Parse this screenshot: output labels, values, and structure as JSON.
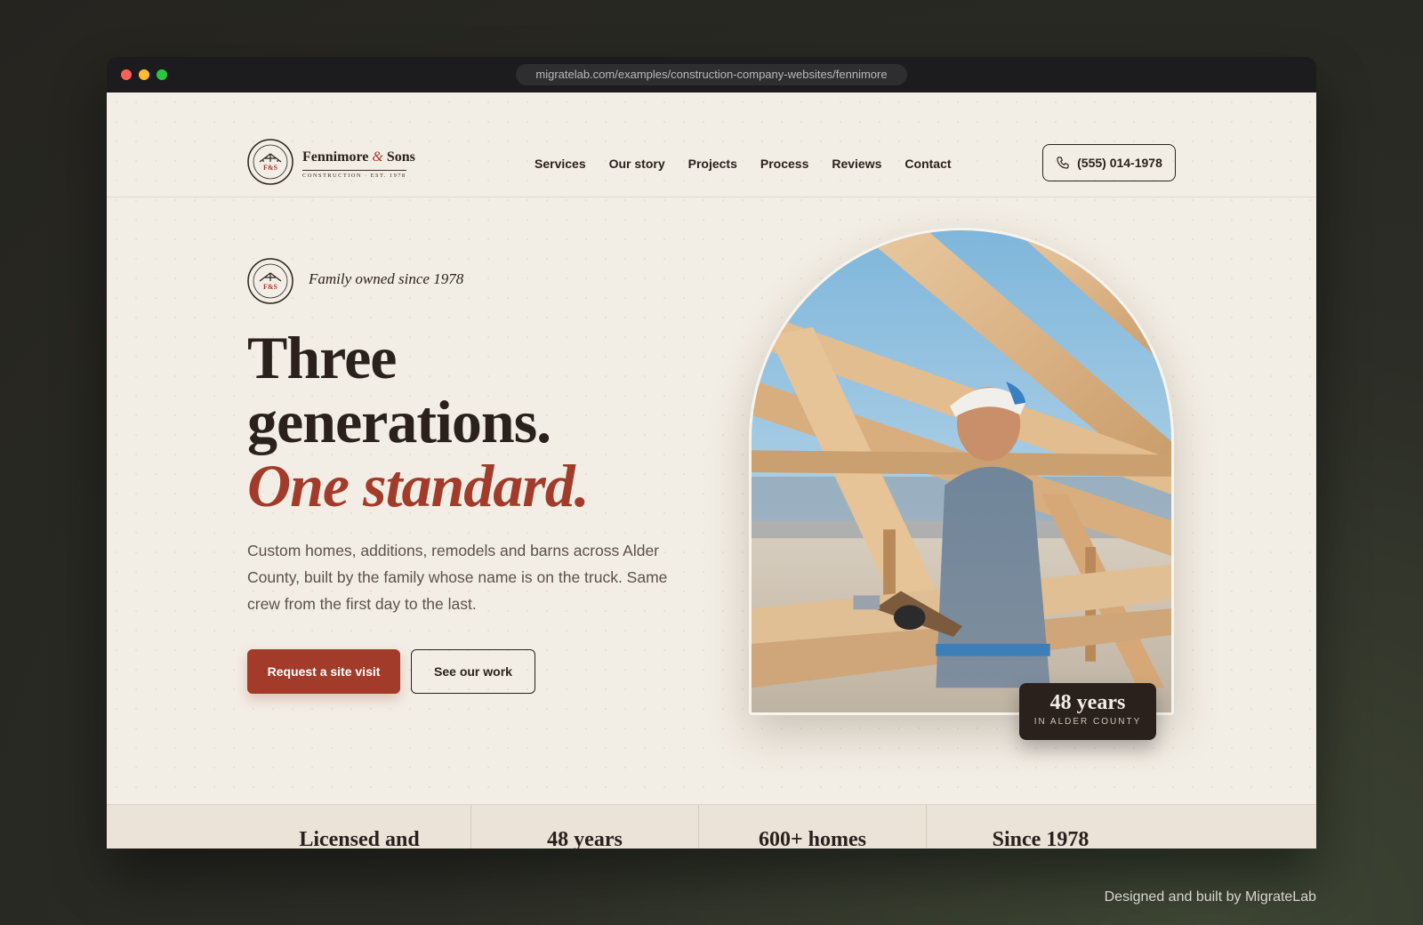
{
  "browser": {
    "url": "migratelab.com/examples/construction-company-websites/fennimore"
  },
  "brand": {
    "name_part1": "Fennimore",
    "name_amp": "&",
    "name_part2": "Sons",
    "tagline": "CONSTRUCTION · EST. 1978",
    "monogram": "F&S"
  },
  "nav": {
    "items": [
      "Services",
      "Our story",
      "Projects",
      "Process",
      "Reviews",
      "Contact"
    ],
    "phone": "(555) 014-1978",
    "phone_icon": "phone-icon"
  },
  "hero": {
    "eyebrow": "Family owned since 1978",
    "headline_line1": "Three",
    "headline_line2": "generations.",
    "headline_accent": "One standard.",
    "lede": "Custom homes, additions, remodels and barns across Alder County, built by the family whose name is on the truck. Same crew from the first day to the last.",
    "cta_primary": "Request a site visit",
    "cta_secondary": "See our work",
    "badge_number": "48 years",
    "badge_caption": "IN ALDER COUNTY"
  },
  "stats": {
    "items": [
      "Licensed and",
      "48 years",
      "600+ homes",
      "Since 1978"
    ]
  },
  "footer": {
    "credit": "Designed and built by MigrateLab"
  },
  "colors": {
    "accent": "#a23b2a",
    "ink": "#2a211c",
    "paper": "#f3eee5"
  }
}
